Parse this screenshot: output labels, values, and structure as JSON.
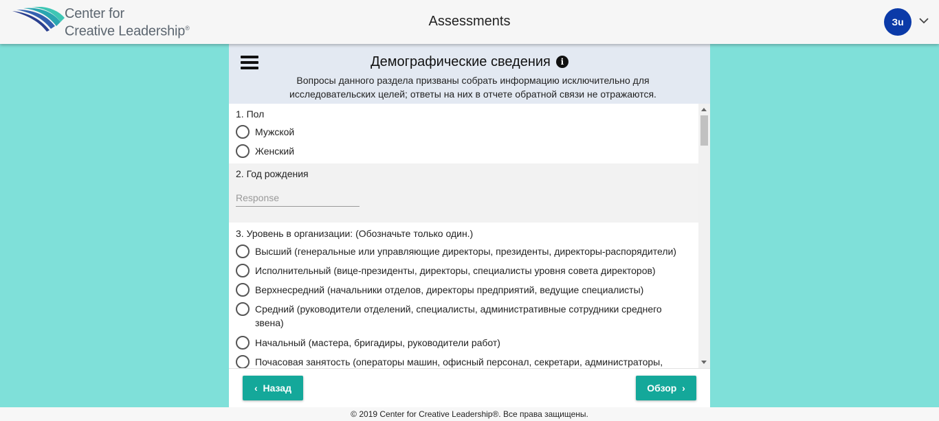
{
  "header": {
    "logo_line1": "Center for",
    "logo_line2": "Creative Leadership",
    "logo_mark": "®",
    "title": "Assessments",
    "avatar_initials": "Зu"
  },
  "section": {
    "title": "Демографические сведения",
    "info_icon": "i",
    "description": "Вопросы данного раздела призваны собрать информацию исключительно для исследовательских целей; ответы на них в отчете обратной связи не отражаются."
  },
  "questions": {
    "q1": {
      "label": "1. Пол",
      "options": [
        "Мужской",
        "Женский"
      ]
    },
    "q2": {
      "label": "2. Год рождения",
      "placeholder": "Response"
    },
    "q3": {
      "label": "3. Уровень в организации: (Обозначьте только один.)",
      "options": [
        "Высший (генеральные или управляющие директоры, президенты, директоры-распорядители)",
        "Исполнительный (вице-президенты, директоры, специалисты уровня совета директоров)",
        "Верхнесредний (начальники отделов, директоры предприятий, ведущие специалисты)",
        "Средний (руководители отделений, специалисты, административные сотрудники среднего звена)",
        "Начальный (мастера, бригадиры, руководители работ)",
        "Почасовая занятость (операторы машин, офисный персонал, секретари, администраторы,"
      ]
    }
  },
  "nav": {
    "back_label": "Назад",
    "back_chevron": "‹",
    "review_label": "Обзор",
    "review_chevron": "›"
  },
  "footer": {
    "copyright": "© 2019 Center for Creative Leadership®. Все права защищены."
  }
}
